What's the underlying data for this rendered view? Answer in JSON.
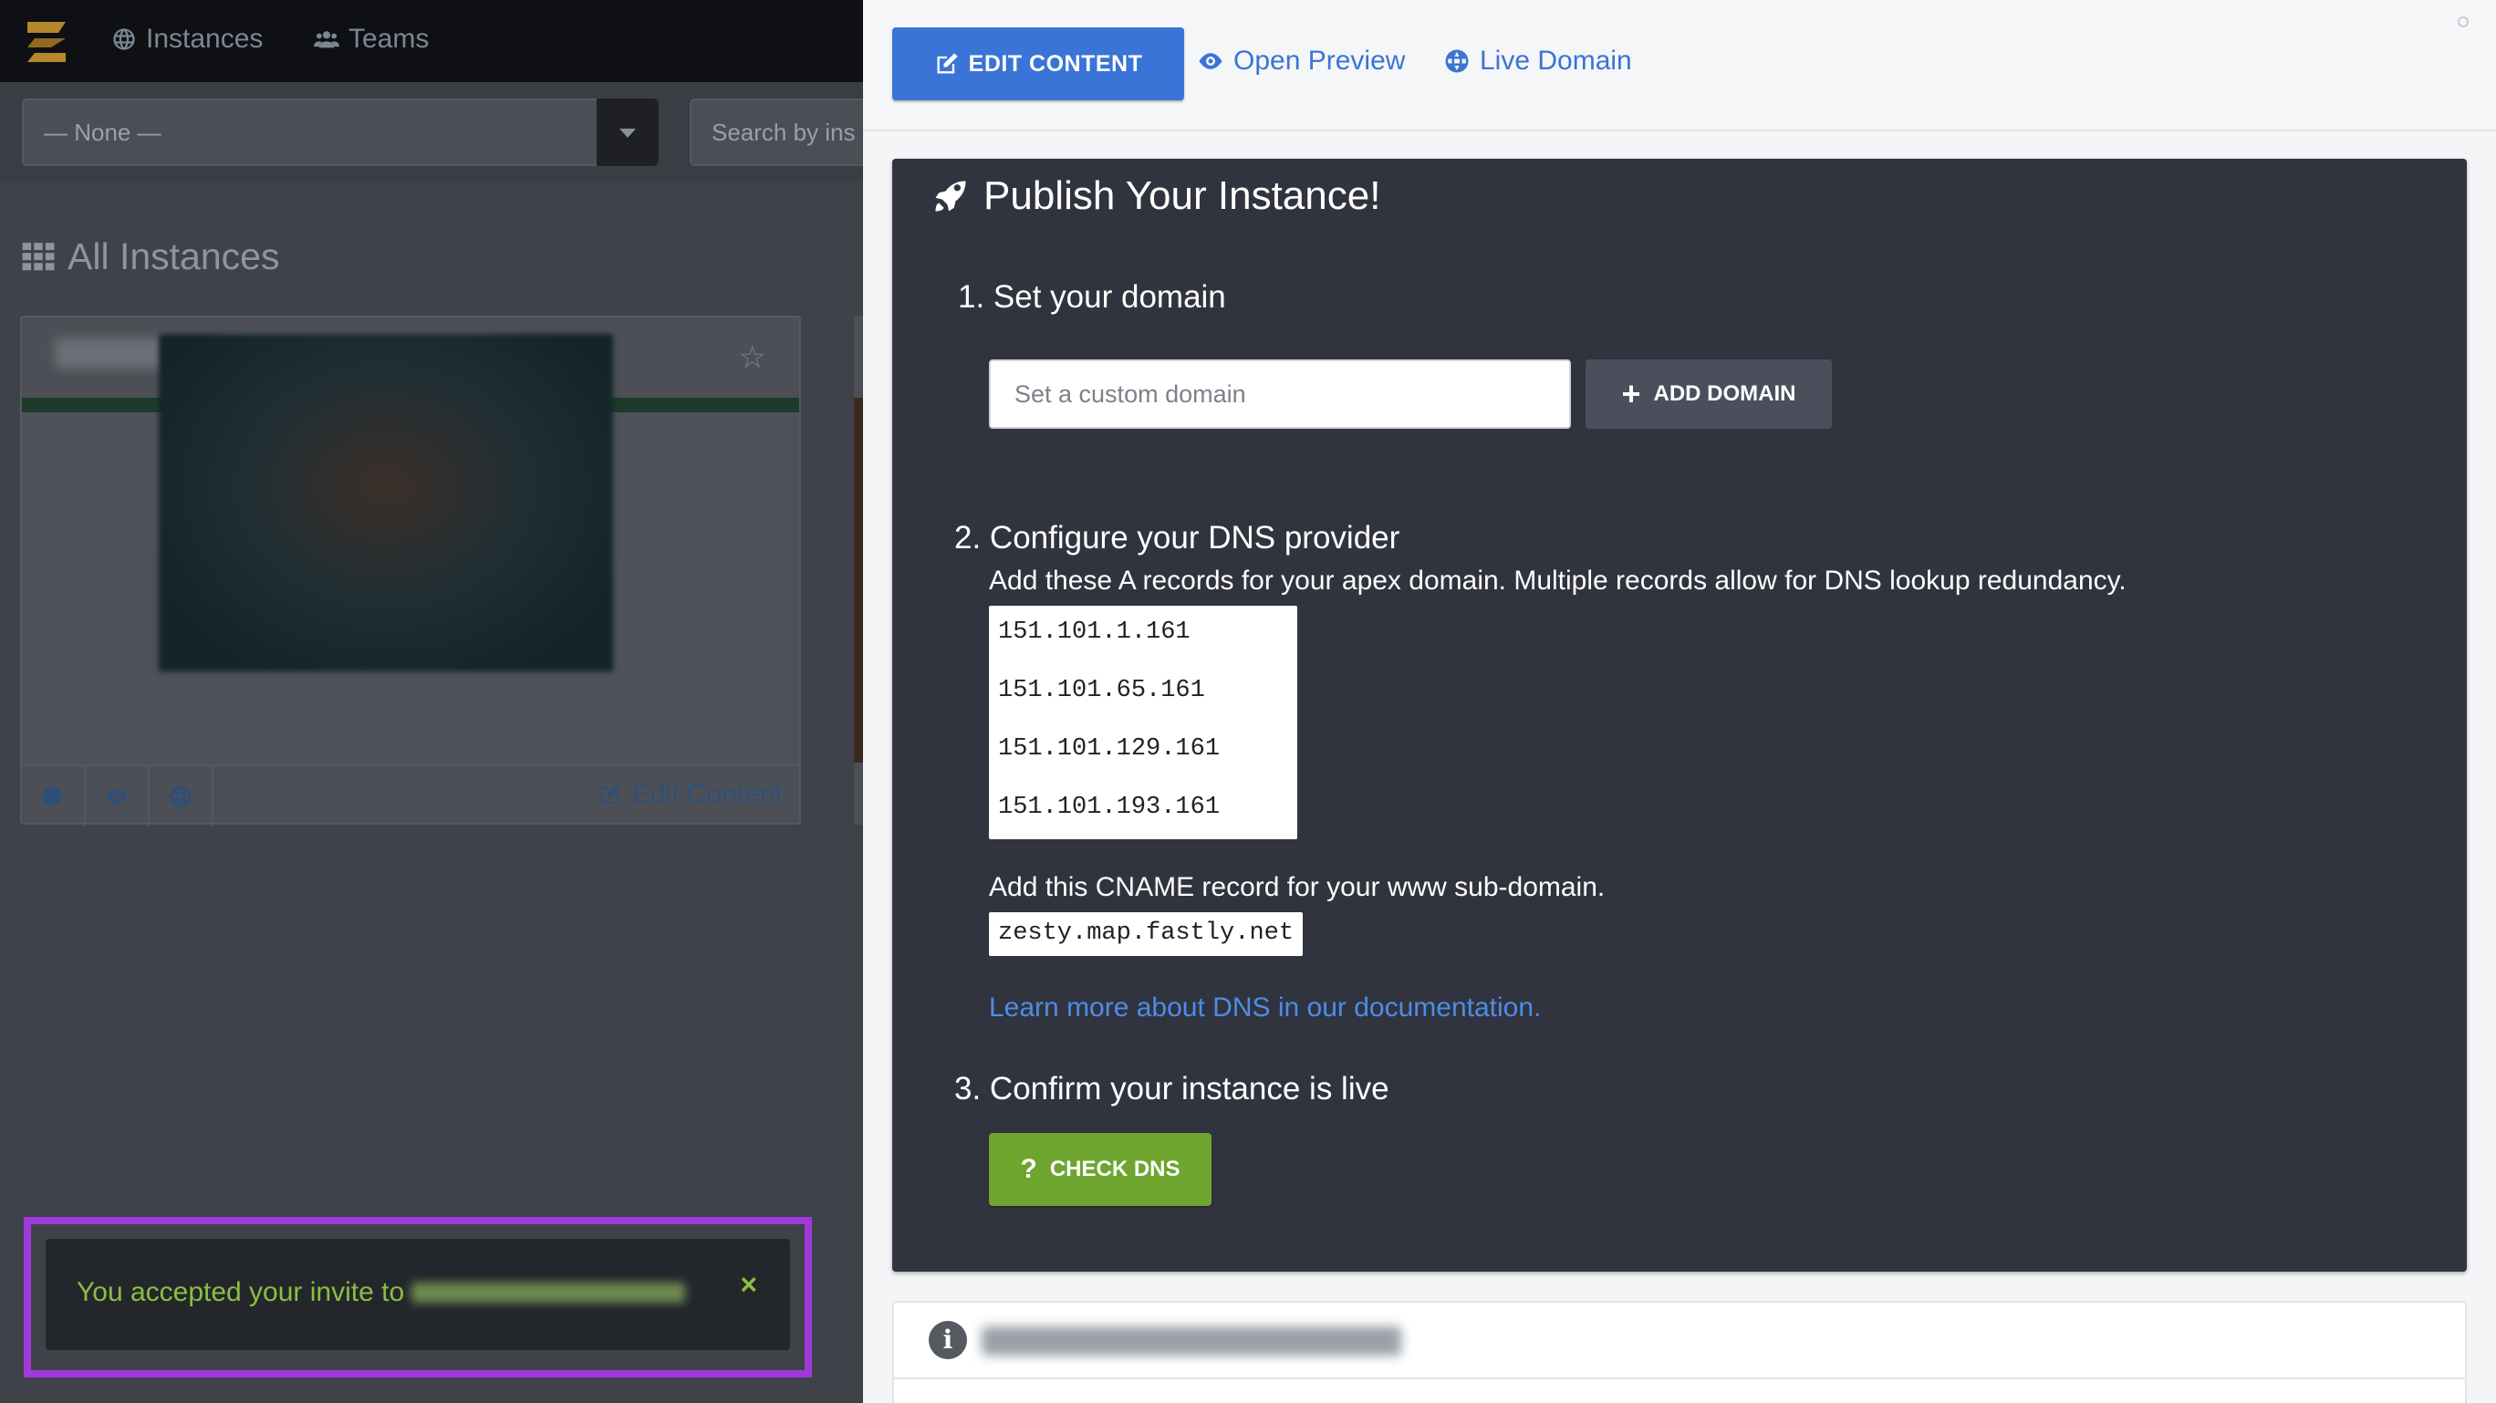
{
  "app": {
    "nav": {
      "instances": "Instances",
      "teams": "Teams"
    },
    "filter": {
      "select_value": "— None —",
      "search_placeholder": "Search by ins"
    },
    "heading": "All Instances",
    "card": {
      "edit_label": "Edit Content"
    }
  },
  "toast": {
    "message": "You accepted your invite to",
    "close": "×",
    "text_color": "#8cbf3f",
    "highlight_color": "#a03ad8"
  },
  "panel": {
    "toolbar": {
      "edit_content": "EDIT CONTENT",
      "open_preview": "Open Preview",
      "live_domain": "Live Domain"
    },
    "publish": {
      "title": "Publish Your Instance!",
      "step1": "1. Set your domain",
      "domain_placeholder": "Set a custom domain",
      "add_domain": "ADD DOMAIN",
      "step2": "2. Configure your DNS provider",
      "a_records_desc": "Add these A records for your apex domain. Multiple records allow for DNS lookup redundancy.",
      "a_records": [
        "151.101.1.161",
        "151.101.65.161",
        "151.101.129.161",
        "151.101.193.161"
      ],
      "cname_desc": "Add this CNAME record for your www sub-domain.",
      "cname": "zesty.map.fastly.net",
      "docs_link": "Learn more about DNS in our documentation.",
      "step3": "3. Confirm your instance is live",
      "check_dns": "CHECK DNS"
    },
    "colors": {
      "primary": "#3a74d6",
      "success": "#6da52f",
      "dark_panel": "#31343e"
    }
  }
}
